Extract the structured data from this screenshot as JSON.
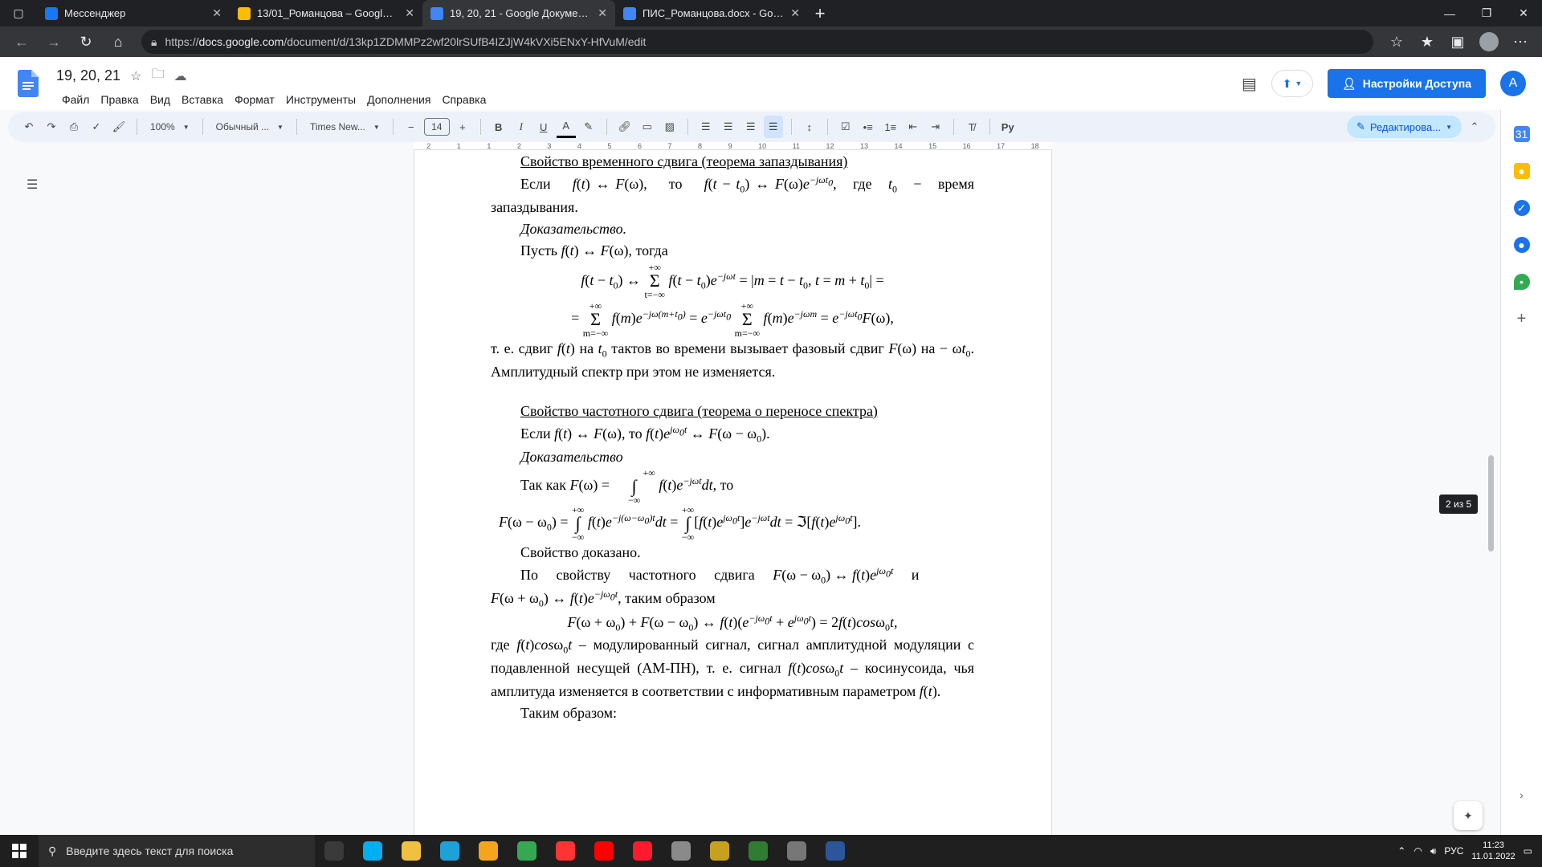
{
  "browser": {
    "tabs": [
      {
        "title": "Мессенджер",
        "active": false,
        "favicon_color": "#1877f2"
      },
      {
        "title": "13/01_Романцова – Google Дис",
        "active": false,
        "favicon_color": "#fbbc04"
      },
      {
        "title": "19, 20, 21 - Google Документы",
        "active": true,
        "favicon_color": "#4285f4"
      },
      {
        "title": "ПИС_Романцова.docx - Google",
        "active": false,
        "favicon_color": "#4285f4"
      }
    ],
    "url_prefix": "https://",
    "url_host": "docs.google.com",
    "url_path": "/document/d/13kp1ZDMMPz2wf20lrSUfB4IZJjW4kVXi5ENxY-HfVuM/edit"
  },
  "docs": {
    "title": "19, 20, 21",
    "menu": [
      "Файл",
      "Правка",
      "Вид",
      "Вставка",
      "Формат",
      "Инструменты",
      "Дополнения",
      "Справка"
    ],
    "share_label": "Настройки Доступа",
    "account_initial": "A",
    "toolbar": {
      "zoom": "100%",
      "style": "Обычный ...",
      "font": "Times New...",
      "font_size": "14",
      "edit_mode": "Редактирова..."
    },
    "ruler_ticks": [
      "2",
      "1",
      "1",
      "2",
      "3",
      "4",
      "5",
      "6",
      "7",
      "8",
      "9",
      "10",
      "11",
      "12",
      "13",
      "14",
      "15",
      "16",
      "17",
      "18"
    ],
    "page_indicator": "2 из 5"
  },
  "content": {
    "h1": "Свойство временного сдвига (теорема запаздывания)",
    "p1a": "Если f(t) ↔ F(ω), то f(t − t",
    "p1b": ") ↔ F(ω)e",
    "p1c": "−jωt",
    "p1d": ", где t",
    "p1e": " − время запаздывания.",
    "proof1": "Доказательство.",
    "p2": "Пусть f(t) ↔ F(ω), тогда",
    "eq1": "f(t − t₀) ↔  Σ f(t − t₀)e^{−jωt} = |m = t − t₀, t = m + t₀| =",
    "eq2": "= Σ f(m)e^{−jω(m+t₀)} = e^{−jωt₀} Σ f(m)e^{−jωm} = e^{−jωt₀}F(ω),",
    "sum_top": "+∞",
    "sum_bot_t": "t=−∞",
    "sum_bot_m": "m=−∞",
    "p3": "т. е. сдвиг f(t) на t₀ тактов во времени вызывает фазовый сдвиг F(ω) на − ωt₀. Амплитудный спектр при этом не изменяется.",
    "h2": "Свойство частотного сдвига (теорема о переносе спектра)",
    "p4": "Если f(t) ↔ F(ω), то f(t)e^{jω₀t} ↔ F(ω − ω₀).",
    "proof2": "Доказательство",
    "p5": "Так как F(ω) = ∫ f(t)e^{−jωt}dt, то",
    "int_top": "+∞",
    "int_bot": "−∞",
    "eq3": "F(ω − ω₀) = ∫ f(t)e^{−j(ω−ω₀)t}dt = ∫[f(t)e^{jω₀t}]e^{−jωt}dt = ℑ[f(t)e^{jω₀t}].",
    "p6": "Свойство доказано.",
    "p7": "По свойству частотного сдвига F(ω − ω₀) ↔ f(t)e^{jω₀t} и",
    "p8": "F(ω + ω₀) ↔ f(t)e^{−jω₀t}, таким образом",
    "eq4": "F(ω + ω₀) + F(ω − ω₀) ↔ f(t)(e^{−jω₀t} + e^{jω₀t}) = 2f(t)cosω₀t,",
    "p9": "где f(t)cosω₀t – модулированный сигнал, сигнал амплитудной модуляции с подавленной несущей (АМ-ПН), т. е. сигнал f(t)cosω₀t – косинусоида, чья амплитуда изменяется в соответствии с информативным параметром f(t).",
    "p10": "Таким образом:"
  },
  "taskbar": {
    "search_placeholder": "Введите здесь текст для поиска",
    "lang": "РУС",
    "time": "11:23",
    "date": "11.01.2022",
    "apps": [
      {
        "name": "task-view",
        "color": "#3a3a3a"
      },
      {
        "name": "skype",
        "color": "#00aff0"
      },
      {
        "name": "explorer",
        "color": "#f0c040"
      },
      {
        "name": "edge",
        "color": "#1da1d8"
      },
      {
        "name": "store",
        "color": "#f4a51c"
      },
      {
        "name": "chrome",
        "color": "#34a853"
      },
      {
        "name": "yandex-browser",
        "color": "#ff3333"
      },
      {
        "name": "yandex",
        "color": "#ff0000"
      },
      {
        "name": "opera",
        "color": "#ff1b2d"
      },
      {
        "name": "media-player",
        "color": "#8a8a8a"
      },
      {
        "name": "app-yellow",
        "color": "#c8a020"
      },
      {
        "name": "maps",
        "color": "#2e7d32"
      },
      {
        "name": "calculator",
        "color": "#777777"
      },
      {
        "name": "word",
        "color": "#2b579a"
      }
    ]
  }
}
